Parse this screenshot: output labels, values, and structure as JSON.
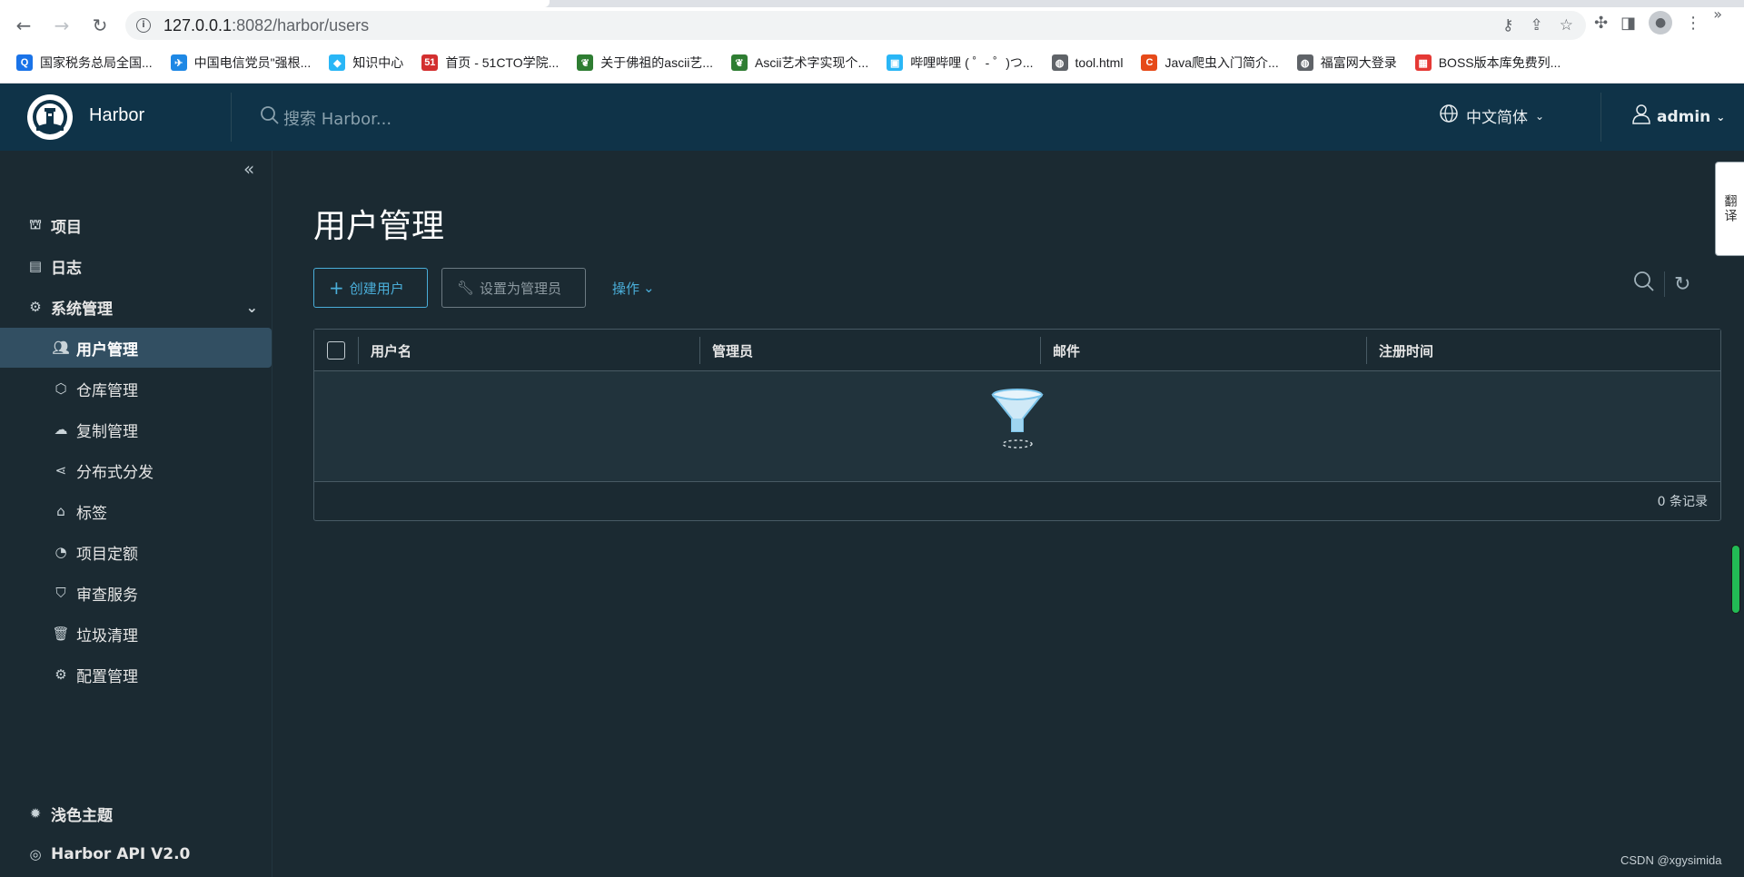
{
  "browser": {
    "url_host": "127.0.0.1",
    "url_path": ":8082/harbor/users",
    "bookmarks": [
      {
        "label": "国家税务总局全国...",
        "color": "#1a73e8",
        "glyph": "Q"
      },
      {
        "label": "中国电信党员\"强根...",
        "color": "#1e88e5",
        "glyph": "✈"
      },
      {
        "label": "知识中心",
        "color": "#29b6f6",
        "glyph": "◆"
      },
      {
        "label": "首页 - 51CTO学院...",
        "color": "#d32f2f",
        "glyph": "51"
      },
      {
        "label": "关于佛祖的ascii艺...",
        "color": "#2e7d32",
        "glyph": "❦"
      },
      {
        "label": "Ascii艺术字实现个...",
        "color": "#2e7d32",
        "glyph": "❦"
      },
      {
        "label": "哔哩哔哩 ( ゜- ゜)つ...",
        "color": "#29b6f6",
        "glyph": "▣"
      },
      {
        "label": "tool.html",
        "color": "#5f6368",
        "glyph": "◍"
      },
      {
        "label": "Java爬虫入门简介...",
        "color": "#e64a19",
        "glyph": "C"
      },
      {
        "label": "福富网大登录",
        "color": "#5f6368",
        "glyph": "◍"
      },
      {
        "label": "BOSS版本库免费列...",
        "color": "#e53935",
        "glyph": "▦"
      }
    ],
    "more": "»"
  },
  "header": {
    "brand": "Harbor",
    "search_placeholder": "搜索 Harbor...",
    "language": "中文简体",
    "user": "admin"
  },
  "sidebar": {
    "items": [
      {
        "label": "项目",
        "icon": "projects-icon",
        "type": "top"
      },
      {
        "label": "日志",
        "icon": "logs-icon",
        "type": "top"
      },
      {
        "label": "系统管理",
        "icon": "admin-icon",
        "type": "top"
      },
      {
        "label": "用户管理",
        "icon": "users-icon",
        "type": "sub"
      },
      {
        "label": "仓库管理",
        "icon": "registry-icon",
        "type": "sub"
      },
      {
        "label": "复制管理",
        "icon": "replication-icon",
        "type": "sub"
      },
      {
        "label": "分布式分发",
        "icon": "distribution-icon",
        "type": "sub"
      },
      {
        "label": "标签",
        "icon": "tag-icon",
        "type": "sub"
      },
      {
        "label": "项目定额",
        "icon": "quota-icon",
        "type": "sub"
      },
      {
        "label": "审查服务",
        "icon": "shield-icon",
        "type": "sub"
      },
      {
        "label": "垃圾清理",
        "icon": "trash-icon",
        "type": "sub"
      },
      {
        "label": "配置管理",
        "icon": "gear-icon",
        "type": "sub"
      }
    ],
    "theme_label": "浅色主题",
    "api_label": "Harbor API V2.0"
  },
  "main": {
    "title": "用户管理",
    "create_button": "创建用户",
    "set_admin_button": "设置为管理员",
    "actions_button": "操作",
    "columns": [
      "用户名",
      "管理员",
      "邮件",
      "注册时间"
    ],
    "footer": "0 条记录"
  },
  "side_tab": "翻译",
  "watermark": "CSDN @xgysimida"
}
